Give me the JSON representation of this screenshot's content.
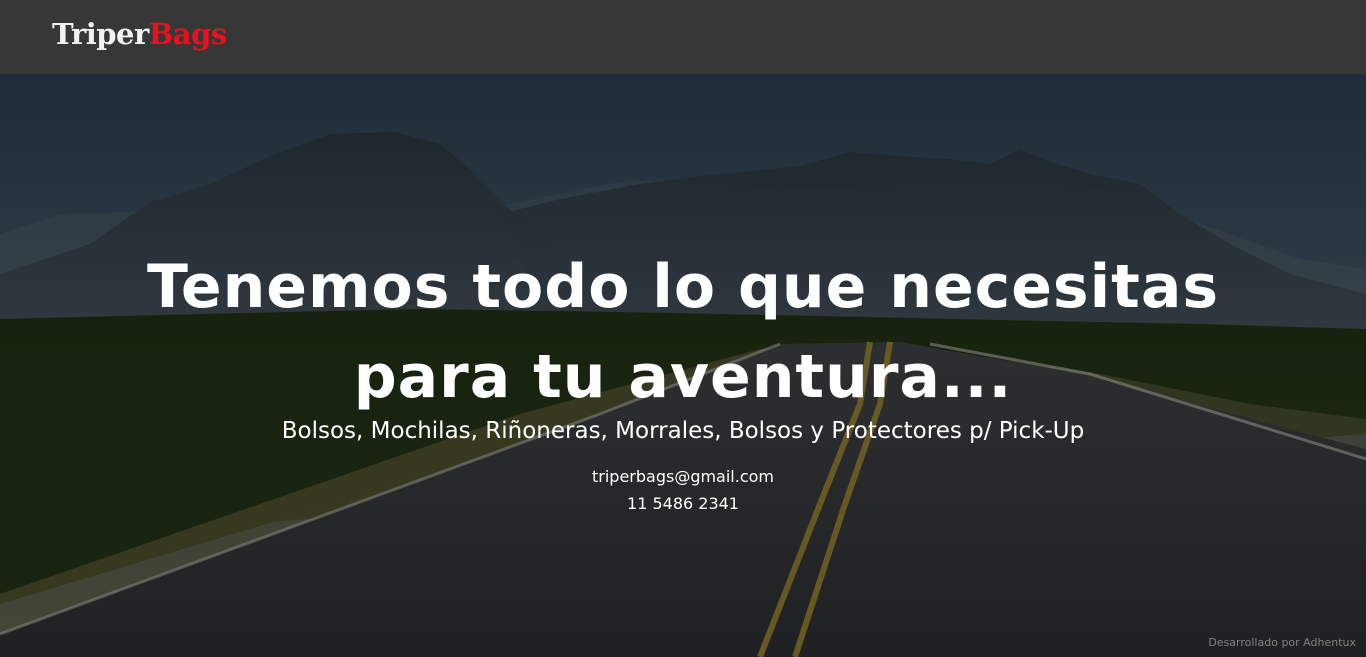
{
  "header": {
    "logo_part1": "Triper",
    "logo_part2": "Bags",
    "logo_color_primary": "#f2f2f2",
    "logo_color_accent": "#e8121f",
    "background_color": "#373737"
  },
  "hero": {
    "headline_line1": "Tenemos todo lo que necesitas",
    "headline_line2": "para tu aventura...",
    "subheadline": "Bolsos, Mochilas, Riñoneras, Morrales, Bolsos y Protectores p/ Pick-Up",
    "email": "triperbags@gmail.com",
    "phone": "11 5486 2341",
    "background_image": "mountain-desert-road-photo"
  },
  "footer": {
    "credit": "Desarrollado por Adhentux"
  }
}
